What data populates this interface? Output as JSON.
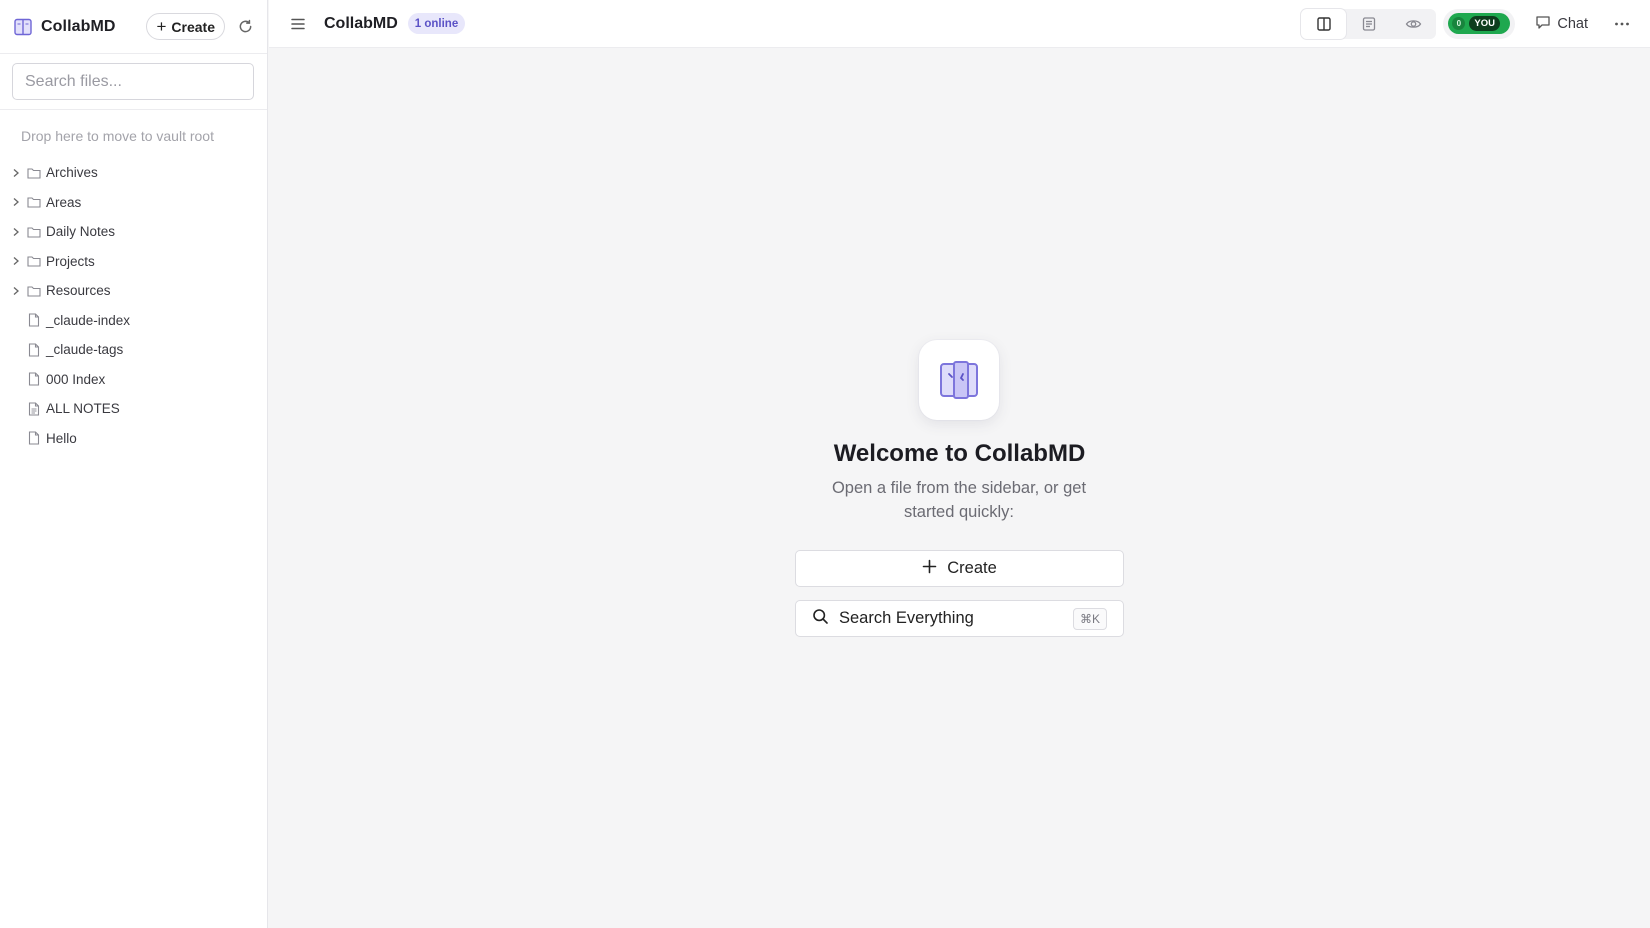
{
  "sidebar": {
    "brand": "CollabMD",
    "create_label": "Create",
    "search_placeholder": "Search files...",
    "drop_hint": "Drop here to move to vault root",
    "items": [
      {
        "label": "Archives",
        "type": "folder"
      },
      {
        "label": "Areas",
        "type": "folder"
      },
      {
        "label": "Daily Notes",
        "type": "folder"
      },
      {
        "label": "Projects",
        "type": "folder"
      },
      {
        "label": "Resources",
        "type": "folder"
      },
      {
        "label": "_claude-index",
        "type": "file"
      },
      {
        "label": "_claude-tags",
        "type": "file"
      },
      {
        "label": "000 Index",
        "type": "file"
      },
      {
        "label": "ALL NOTES",
        "type": "file"
      },
      {
        "label": "Hello",
        "type": "file"
      }
    ]
  },
  "topbar": {
    "title": "CollabMD",
    "online": "1 online",
    "presence_count": "0",
    "presence_you": "YOU",
    "chat_label": "Chat",
    "view_modes": [
      "split-view",
      "editor-view",
      "preview-view"
    ],
    "active_view": "split-view"
  },
  "welcome": {
    "title": "Welcome to CollabMD",
    "subtitle": "Open a file from the sidebar, or get started quickly:",
    "create_label": "Create",
    "search_label": "Search Everything",
    "search_shortcut": "⌘K"
  },
  "colors": {
    "accent": "#5b52c6",
    "online_badge_bg": "#e8e7fb",
    "presence_green": "#1fa84f"
  }
}
